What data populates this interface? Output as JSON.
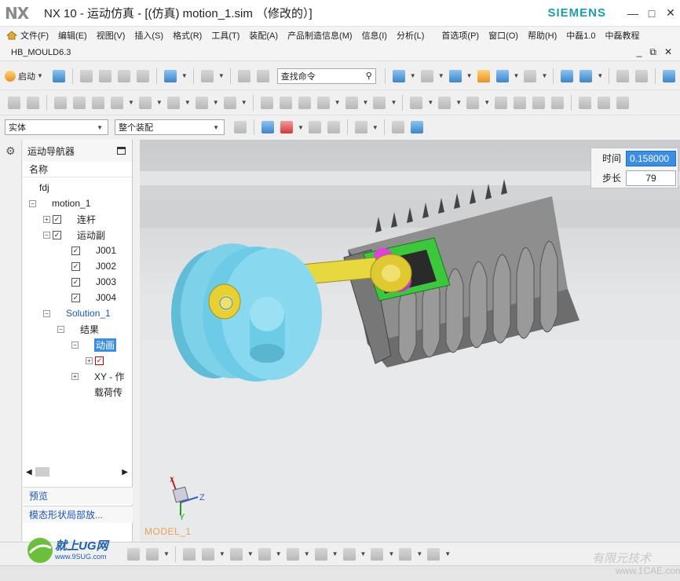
{
  "titlebar": {
    "logo": "NX",
    "title": "NX 10 - 运动仿真 - [(仿真) motion_1.sim （修改的）]",
    "brand": "SIEMENS",
    "minimize": "—",
    "maximize": "□",
    "close": "✕"
  },
  "menubar": {
    "items": [
      "文件(F)",
      "编辑(E)",
      "视图(V)",
      "插入(S)",
      "格式(R)",
      "工具(T)",
      "装配(A)",
      "产品制造信息(M)",
      "信息(I)",
      "分析(L)",
      "首选项(P)",
      "窗口(O)",
      "帮助(H)",
      "中磊1.0",
      "中磊教程"
    ]
  },
  "docbar": {
    "tab": "HB_MOULD6.3",
    "minimize": "_",
    "restore": "⧉",
    "close": "✕"
  },
  "toolbar": {
    "start_label": "启动",
    "search_placeholder": "查找命令",
    "filter_value": "实体",
    "assembly_value": "整个装配"
  },
  "navigator": {
    "title": "运动导航器",
    "column": "名称",
    "tree": {
      "root": "fdj",
      "motion": "motion_1",
      "links": "连杆",
      "joints": "运动副",
      "j1": "J001",
      "j2": "J002",
      "j3": "J003",
      "j4": "J004",
      "solution": "Solution_1",
      "results": "结果",
      "animation": "动画",
      "anim_child": "",
      "xy": "XY - 作",
      "load": "载荷传"
    },
    "panel_preview": "预览",
    "panel_modal": "模态形状局部放..."
  },
  "viewport": {
    "model_label": "MODEL_1",
    "time_label": "时间",
    "time_value": "0.158000",
    "step_label": "步长",
    "step_value": "79",
    "axis_z": "Z",
    "axis_y": "Y",
    "axis_x": "X"
  },
  "watermark": {
    "left_title": "就上UG网",
    "left_url": "www.9SUG.com",
    "right_title": "有限元技术",
    "right_url": "www.1CAE.com"
  }
}
